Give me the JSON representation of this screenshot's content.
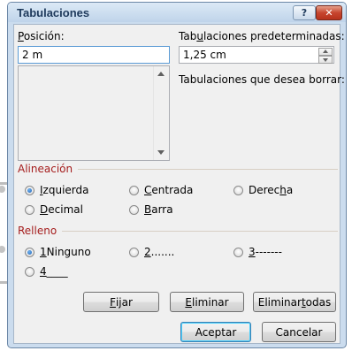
{
  "dialog": {
    "title": "Tabulaciones",
    "help_label": "?",
    "close_label": "✕"
  },
  "position": {
    "label_pre": "",
    "label_key": "P",
    "label_post": "osición:",
    "value": "2 m"
  },
  "default_tabs": {
    "label_pre": "Tab",
    "label_key": "u",
    "label_post": "laciones predeterminadas:",
    "value": "1,25 cm"
  },
  "clear_tabs_label": "Tabulaciones que desea borrar:",
  "alignment": {
    "header": "Alineación",
    "options": [
      {
        "key": "I",
        "rest": "zquierda",
        "pre": "",
        "selected": true
      },
      {
        "key": "C",
        "rest": "entrada",
        "pre": "",
        "selected": false
      },
      {
        "key": "h",
        "rest": "a",
        "pre": "Derec",
        "selected": false
      },
      {
        "key": "D",
        "rest": "ecimal",
        "pre": "",
        "selected": false
      },
      {
        "key": "B",
        "rest": "arra",
        "pre": "",
        "selected": false
      }
    ]
  },
  "leader": {
    "header": "Relleno",
    "options": [
      {
        "key": "1",
        "rest": " Ninguno",
        "selected": true
      },
      {
        "key": "2",
        "rest": " .......",
        "selected": false
      },
      {
        "key": "3",
        "rest": " -------",
        "selected": false
      },
      {
        "key": "4",
        "rest": " ____",
        "selected": false
      }
    ]
  },
  "buttons": {
    "set": {
      "pre": "",
      "key": "F",
      "post": "ijar"
    },
    "clear": {
      "pre": "",
      "key": "E",
      "post": "liminar"
    },
    "clear_all": {
      "pre": "Eliminar ",
      "key": "t",
      "post": "odas"
    },
    "ok": "Aceptar",
    "cancel": "Cancelar"
  },
  "colors": {
    "section_header": "#a51d1d",
    "title_text": "#1e395b",
    "close_button": "#c7452e",
    "radio_selected": "#1d5fb4"
  }
}
